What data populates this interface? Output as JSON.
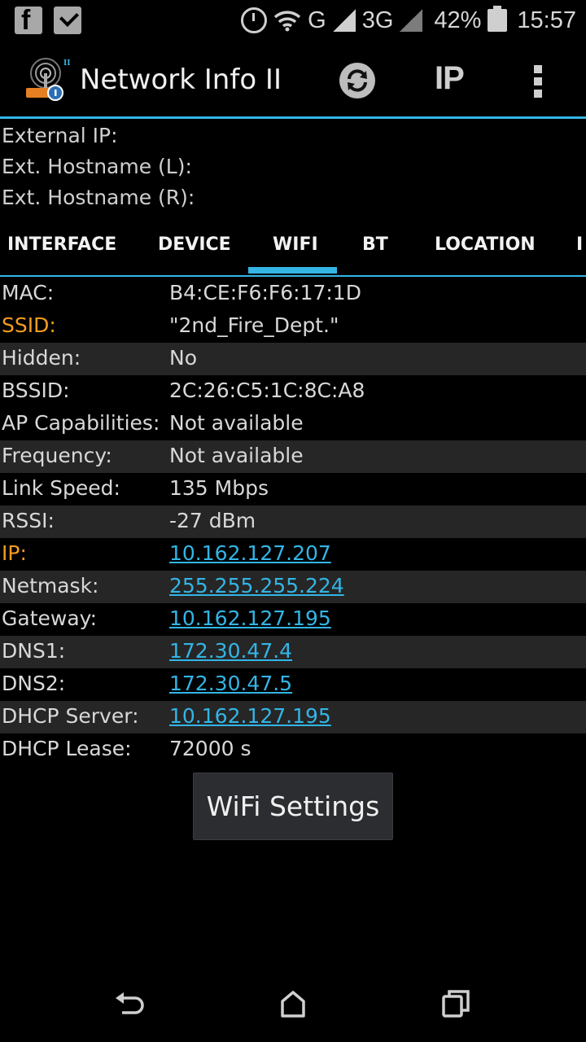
{
  "status_bar": {
    "left_icons": [
      "facebook-icon",
      "clipboard-check-icon"
    ],
    "network_g": "G",
    "network_3g": "3G",
    "battery_percent": "42%",
    "time": "15:57"
  },
  "action_bar": {
    "title": "Network Info II",
    "ip_button": "IP",
    "icons": [
      "app-logo-icon",
      "refresh-icon",
      "overflow-menu-icon"
    ]
  },
  "external": {
    "external_ip": "External IP:",
    "ext_hostname_l": "Ext. Hostname (L):",
    "ext_hostname_r": "Ext. Hostname (R):"
  },
  "tabs": {
    "interface": "INTERFACE",
    "device": "DEVICE",
    "wifi": "WIFI",
    "bt": "BT",
    "location": "LOCATION",
    "ipv6_partial": "I"
  },
  "active_tab": "WIFI",
  "wifi_info": {
    "rows": [
      {
        "label": "MAC:",
        "value": "B4:CE:F6:F6:17:1D"
      },
      {
        "label": "SSID:",
        "value": "\"2nd_Fire_Dept.\""
      },
      {
        "label": "Hidden:",
        "value": "No"
      },
      {
        "label": "BSSID:",
        "value": "2C:26:C5:1C:8C:A8"
      },
      {
        "label": "AP Capabilities:",
        "value": "Not available"
      },
      {
        "label": "Frequency:",
        "value": "Not available"
      },
      {
        "label": "Link Speed:",
        "value": "135 Mbps"
      },
      {
        "label": "RSSI:",
        "value": "-27 dBm"
      },
      {
        "label": "IP:",
        "value": "10.162.127.207"
      },
      {
        "label": "Netmask:",
        "value": "255.255.255.224"
      },
      {
        "label": "Gateway:",
        "value": "10.162.127.195"
      },
      {
        "label": "DNS1:",
        "value": "172.30.47.4"
      },
      {
        "label": "DNS2:",
        "value": "172.30.47.5"
      },
      {
        "label": "DHCP Server:",
        "value": "10.162.127.195"
      },
      {
        "label": "DHCP Lease:",
        "value": "72000 s"
      }
    ]
  },
  "wifi_settings_button": "WiFi Settings",
  "colors": {
    "accent": "#33b5e5",
    "highlight_label": "#f39c1e",
    "shaded_row": "#262626",
    "background": "#000000"
  },
  "nav_bar": {
    "icons": [
      "back-icon",
      "home-icon",
      "recents-icon"
    ]
  }
}
